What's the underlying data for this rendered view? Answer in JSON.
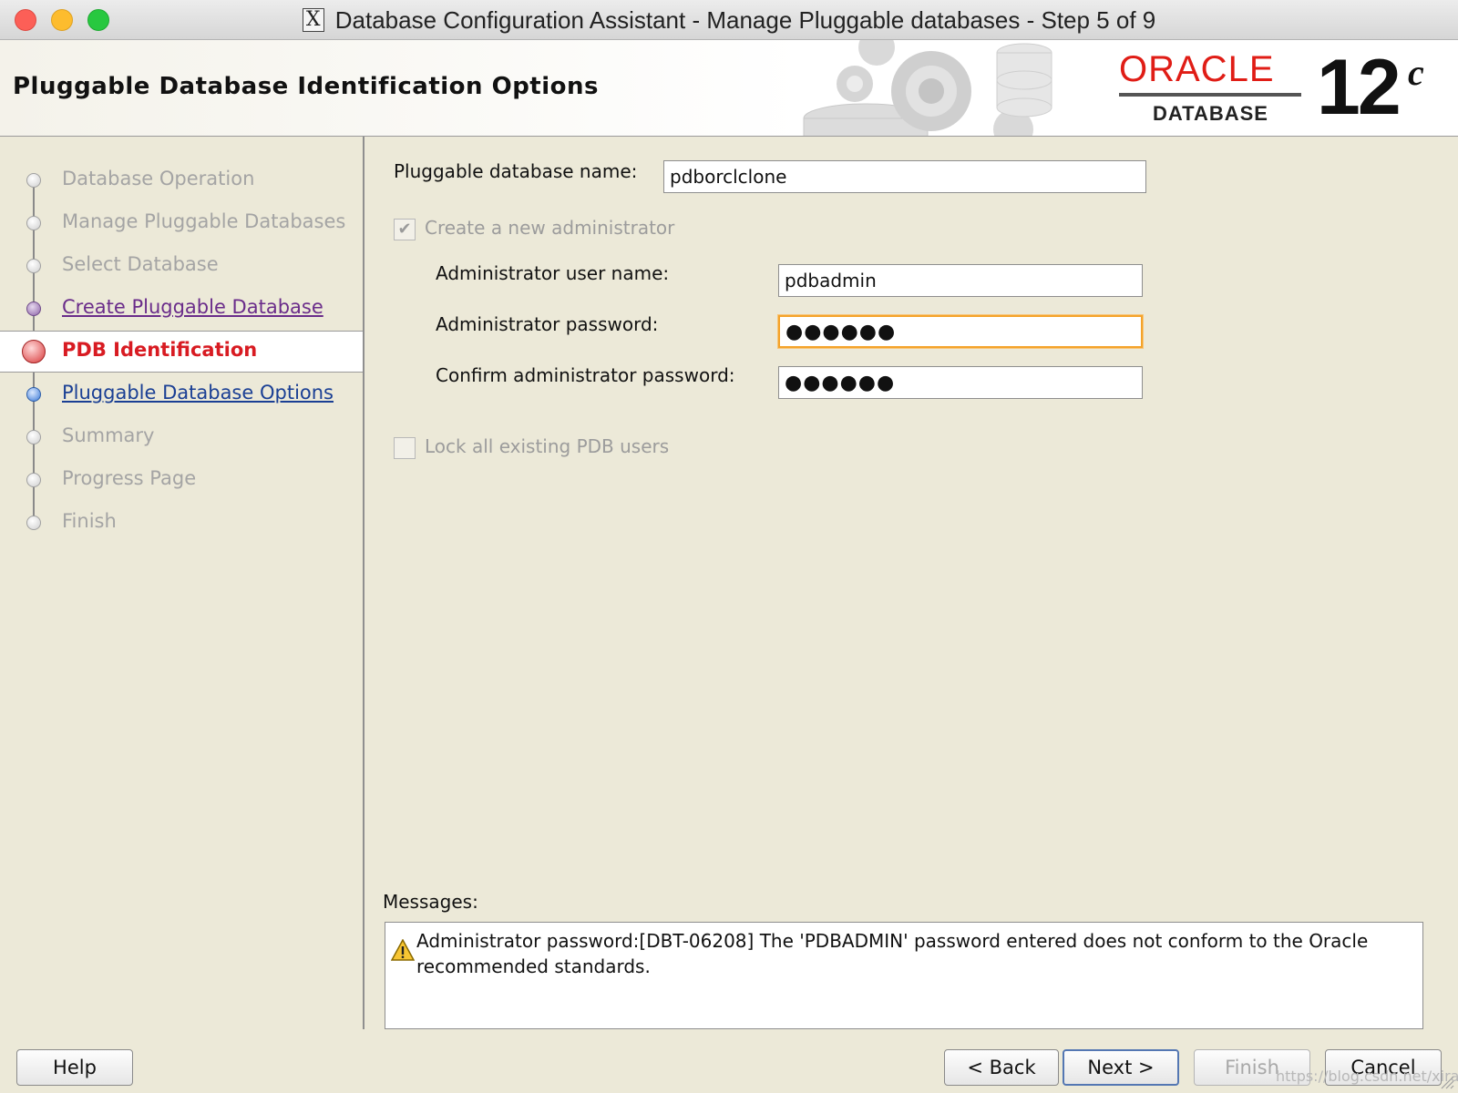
{
  "window": {
    "title": "Database Configuration Assistant - Manage Pluggable databases - Step 5 of 9",
    "x_glyph": "X"
  },
  "header": {
    "page_title": "Pluggable Database Identification Options",
    "logo_word": "ORACLE",
    "logo_product": "DATABASE",
    "version": "12",
    "version_sup": "c"
  },
  "nav": {
    "steps": [
      {
        "label": "Database Operation",
        "state": "completed"
      },
      {
        "label": "Manage Pluggable Databases",
        "state": "completed"
      },
      {
        "label": "Select Database",
        "state": "completed"
      },
      {
        "label": "Create Pluggable Database",
        "state": "visited-link"
      },
      {
        "label": "PDB Identification",
        "state": "current"
      },
      {
        "label": "Pluggable Database Options",
        "state": "next-link"
      },
      {
        "label": "Summary",
        "state": "pending"
      },
      {
        "label": "Progress Page",
        "state": "pending"
      },
      {
        "label": "Finish",
        "state": "pending"
      }
    ]
  },
  "form": {
    "pdb_name_label": "Pluggable database name:",
    "pdb_name_value": "pdborclclone",
    "create_admin_label": "Create a new administrator",
    "create_admin_checked": true,
    "admin_user_label": "Administrator user name:",
    "admin_user_value": "pdbadmin",
    "admin_pwd_label": "Administrator password:",
    "admin_pwd_value": "●●●●●●",
    "confirm_pwd_label": "Confirm administrator password:",
    "confirm_pwd_value": "●●●●●●",
    "lock_users_label": "Lock all existing PDB users",
    "lock_users_checked": false
  },
  "messages": {
    "label": "Messages:",
    "text": "Administrator password:[DBT-06208] The 'PDBADMIN' password entered does not conform to the Oracle recommended standards."
  },
  "buttons": {
    "help": "Help",
    "back": "< Back",
    "next": "Next >",
    "finish": "Finish",
    "cancel": "Cancel"
  },
  "watermark": "https://blog.csdn.net/xiral107",
  "colors": {
    "background": "#ece9d8",
    "current_step": "#d81b22",
    "visited_link": "#6a2c8a",
    "next_link": "#1a3f94",
    "focus_ring": "#f4a32a",
    "oracle_red": "#e01d16"
  }
}
